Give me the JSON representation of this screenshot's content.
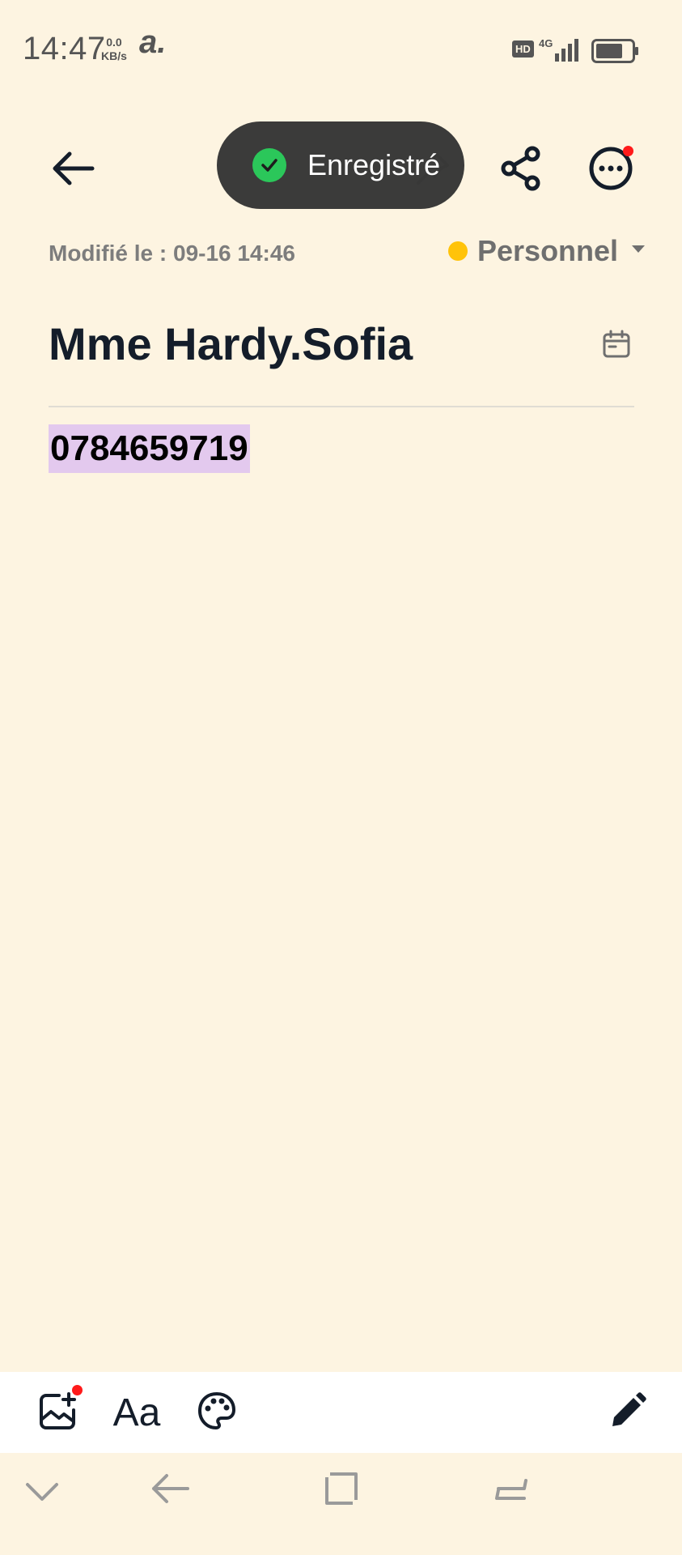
{
  "status_bar": {
    "time": "14:47",
    "speed_value": "0.0",
    "speed_unit": "KB/s",
    "carrier_glyph": "a.",
    "hd_badge": "HD",
    "network": "4G"
  },
  "toast": {
    "text": "Enregistré",
    "icon": "check-circle-icon",
    "color": "#2bc75a"
  },
  "header": {
    "back_icon": "arrow-left-icon",
    "pin_icon": "pin-icon",
    "share_icon": "share-icon",
    "more_icon": "more-horizontal-icon"
  },
  "note": {
    "modified": "Modifié le : 09-16 14:46",
    "category": "Personnel",
    "category_color": "#ffc30a",
    "title": "Mme Hardy.Sofia",
    "body": "0784659719",
    "highlight_color": "#e3c9ee"
  },
  "toolbar": {
    "text_format_label": "Aa",
    "icons": [
      "image-add-icon",
      "text-format-icon",
      "palette-icon",
      "pencil-icon"
    ]
  },
  "colors": {
    "background": "#fdf4e1",
    "text": "#141d2a",
    "notification_dot": "#ff1a1a"
  }
}
